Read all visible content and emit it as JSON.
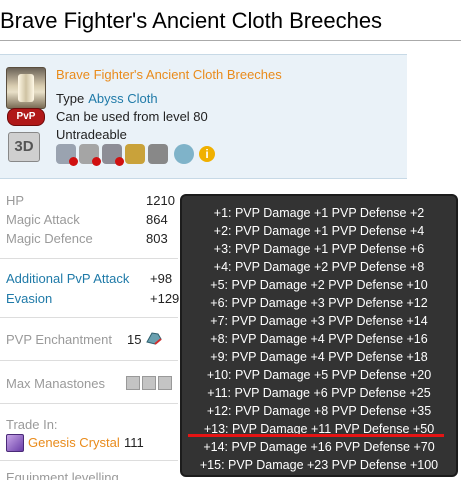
{
  "page": {
    "title": "Brave Fighter's Ancient Cloth Breeches"
  },
  "item": {
    "name": "Brave Fighter's Ancient Cloth Breeches",
    "type_label": "Type",
    "type_value": "Abyss Cloth",
    "level_text": "Can be used from level 80",
    "trade_text": "Untradeable",
    "pvp_badge": "PvP",
    "badge_3d": "3D",
    "flag_icons": [
      "cannot-store-icon",
      "cannot-trade-icon",
      "cannot-sell-icon",
      "kinah-icon",
      "dye-icon",
      "sphere-icon",
      "info-icon"
    ]
  },
  "stats": [
    {
      "label": "HP",
      "value": "1210"
    },
    {
      "label": "Magic Attack",
      "value": "864"
    },
    {
      "label": "Magic Defence",
      "value": "803"
    }
  ],
  "bonus": [
    {
      "label": "Additional PvP Attack",
      "value": "+98"
    },
    {
      "label": "Evasion",
      "value": "+129"
    }
  ],
  "enchant": {
    "label": "PVP Enchantment",
    "value": "15"
  },
  "manastones": {
    "label": "Max Manastones",
    "count": 3
  },
  "trade": {
    "label": "Trade In:",
    "item_name": "Genesis Crystal",
    "item_count": "111"
  },
  "cut_label": "Equipment levelling",
  "tooltip": {
    "lines": [
      "+1: PVP Damage +1 PVP Defense +2",
      "+2: PVP Damage +1 PVP Defense +4",
      "+3: PVP Damage +1 PVP Defense +6",
      "+4: PVP Damage +2 PVP Defense +8",
      "+5: PVP Damage +2 PVP Defense +10",
      "+6: PVP Damage +3 PVP Defense +12",
      "+7: PVP Damage +3 PVP Defense +14",
      "+8: PVP Damage +4 PVP Defense +16",
      "+9: PVP Damage +4 PVP Defense +18",
      "+10: PVP Damage +5 PVP Defense +20",
      "+11: PVP Damage +6 PVP Defense +25",
      "+12: PVP Damage +8 PVP Defense +35",
      "+13: PVP Damage +11 PVP Defense +50",
      "+14: PVP Damage +16 PVP Defense +70",
      "+15: PVP Damage +23 PVP Defense +100"
    ],
    "highlight_color": "#e51414"
  }
}
